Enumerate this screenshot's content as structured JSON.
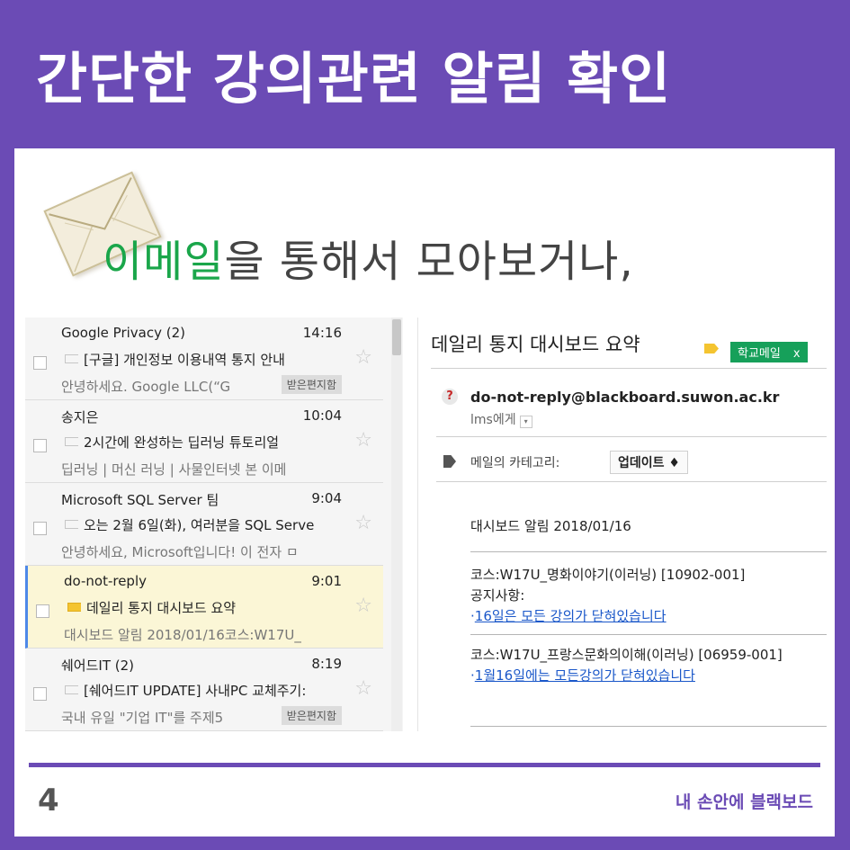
{
  "header": {
    "title": "간단한 강의관련 알림 확인"
  },
  "intro": {
    "accent": "이메일",
    "rest": "을 통해서 모아보거나,"
  },
  "inbox": {
    "rows": [
      {
        "sender": "Google Privacy (2)",
        "time": "14:16",
        "subject": "[구글] 개인정보 이용내역 통지 안내",
        "snippet": "안녕하세요. Google LLC(“G",
        "label": "받은편지함",
        "selected": false,
        "tag_color": "none"
      },
      {
        "sender": "송지은",
        "time": "10:04",
        "subject": "2시간에 완성하는 딥러닝 튜토리얼",
        "snippet": "딥러닝 | 머신 러닝 | 사물인터넷 본 이메",
        "label": "",
        "selected": false,
        "tag_color": "none"
      },
      {
        "sender": "Microsoft SQL Server 팀",
        "time": "9:04",
        "subject": "오는 2월 6일(화), 여러분을 SQL Serve",
        "snippet": "안녕하세요, Microsoft입니다! 이 전자 ㅁ",
        "label": "",
        "selected": false,
        "tag_color": "none"
      },
      {
        "sender": "do-not-reply",
        "time": "9:01",
        "subject": "데일리 통지 대시보드 요약",
        "snippet": "대시보드 알림 2018/01/16코스:W17U_",
        "label": "",
        "selected": true,
        "tag_color": "#f4c430"
      },
      {
        "sender": "쉐어드IT (2)",
        "time": "8:19",
        "subject": "[쉐어드IT UPDATE] 사내PC 교체주기:",
        "snippet": "국내 유일 \"기업 IT\"를 주제5",
        "label": "받은편지함",
        "selected": false,
        "tag_color": "none"
      }
    ]
  },
  "mail": {
    "subject": "데일리 통지 대시보드 요약",
    "school_label": "학교메일",
    "school_label_close": "x",
    "from": "do-not-reply@blackboard.suwon.ac.kr",
    "to": "lms에게",
    "to_caret": "▾",
    "category_label": "메일의 카테고리:",
    "category_value": "업데이트 ♦",
    "heading": "대시보드 알림 2018/01/16",
    "course1": "코스:W17U_명화이야기(이러닝) [10902-001]",
    "notice": "공지사항:",
    "link1_bullet": "·",
    "link1": "16일은 모든 강의가 닫혀있습니다",
    "course2": "코스:W17U_프랑스문화의이해(이러닝) [06959-001]",
    "link2_bullet": "·",
    "link2": "1월16일에는 모든강의가 닫혀있습니다"
  },
  "footer": {
    "page_number": "4",
    "brand": "내 손안에 블랙보드"
  },
  "colors": {
    "brand_purple": "#6b4bb5",
    "accent_green": "#1aa64a",
    "label_green": "#16a05a",
    "link_blue": "#1a57c9"
  },
  "icons": {
    "envelope": "envelope-icon",
    "star": "star-icon",
    "tag": "tag-icon",
    "help": "question-icon"
  }
}
